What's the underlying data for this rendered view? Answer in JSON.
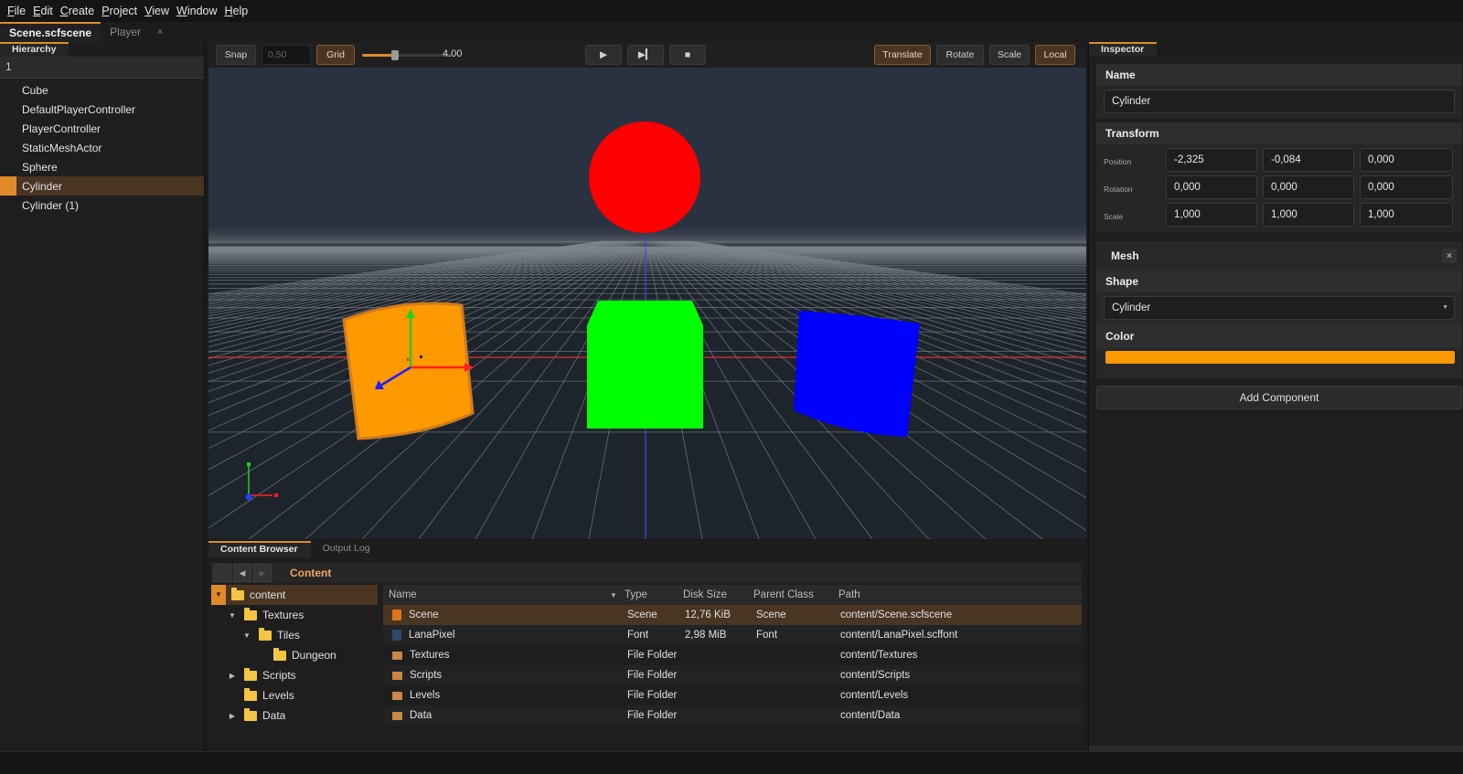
{
  "menu": [
    {
      "accel": "F",
      "rest": "ile"
    },
    {
      "accel": "E",
      "rest": "dit"
    },
    {
      "accel": "C",
      "rest": "reate"
    },
    {
      "accel": "P",
      "rest": "roject"
    },
    {
      "accel": "V",
      "rest": "iew"
    },
    {
      "accel": "W",
      "rest": "indow"
    },
    {
      "accel": "H",
      "rest": "elp"
    }
  ],
  "doc_tabs": {
    "active": "Scene.scfscene",
    "second": "Player",
    "close_glyph": "×"
  },
  "hierarchy": {
    "title": "Hierarchy",
    "search_value": "1",
    "items": [
      "Cube",
      "DefaultPlayerController",
      "PlayerController",
      "StaticMeshActor",
      "Sphere",
      "Cylinder",
      "Cylinder (1)"
    ],
    "selected_index": 5
  },
  "viewport_toolbar": {
    "snap_label": "Snap",
    "snap_value": "0,50",
    "grid_label": "Grid",
    "grid_value": "4.00",
    "grid_slider_level": 0.37,
    "play_glyph": "▶",
    "step_glyph": "▶▎",
    "stop_glyph": "■",
    "translate_label": "Translate",
    "rotate_label": "Rotate",
    "scale_label": "Scale",
    "local_label": "Local"
  },
  "scene_colors": {
    "sky": "#2a3140",
    "floor": "#1e242c",
    "sphere": "#ff0000",
    "cube": "#00ff00",
    "cylinder_left": "#ff9900",
    "cylinder_right": "#0000ff"
  },
  "content_browser": {
    "tabs": [
      "Content Browser",
      "Output Log"
    ],
    "breadcrumb": "Content",
    "nav": {
      "back": "◀",
      "forward": "▶"
    },
    "tree": [
      {
        "label": "content",
        "caret": "▼"
      },
      {
        "label": "Textures",
        "caret": "▼"
      },
      {
        "label": "Tiles",
        "caret": "▼"
      },
      {
        "label": "Dungeon",
        "caret": ""
      },
      {
        "label": "Scripts",
        "caret": "▶"
      },
      {
        "label": "Levels",
        "caret": ""
      },
      {
        "label": "Data",
        "caret": "▶"
      }
    ],
    "columns": {
      "name": "Name",
      "type": "Type",
      "size": "Disk Size",
      "parent": "Parent Class",
      "path": "Path",
      "sort_glyph": "▼"
    },
    "rows": [
      {
        "name": "Scene",
        "type": "Scene",
        "size": "12,76 KiB",
        "parent": "Scene",
        "path": "content/Scene.scfscene",
        "icon": "scene-icon"
      },
      {
        "name": "LanaPixel",
        "type": "Font",
        "size": "2,98 MiB",
        "parent": "Font",
        "path": "content/LanaPixel.scffont",
        "icon": "font-icon"
      },
      {
        "name": "Textures",
        "type": "File Folder",
        "size": "",
        "parent": "",
        "path": "content/Textures",
        "icon": "folder-icon"
      },
      {
        "name": "Scripts",
        "type": "File Folder",
        "size": "",
        "parent": "",
        "path": "content/Scripts",
        "icon": "folder-icon"
      },
      {
        "name": "Levels",
        "type": "File Folder",
        "size": "",
        "parent": "",
        "path": "content/Levels",
        "icon": "folder-icon"
      },
      {
        "name": "Data",
        "type": "File Folder",
        "size": "",
        "parent": "",
        "path": "content/Data",
        "icon": "folder-icon"
      }
    ]
  },
  "inspector": {
    "title": "Inspector",
    "name_header": "Name",
    "name_value": "Cylinder",
    "transform_header": "Transform",
    "position_label": "Position",
    "rotation_label": "Rotation",
    "scale_label": "Scale",
    "position": [
      "-2,325",
      "-0,084",
      "0,000"
    ],
    "rotation": [
      "0,000",
      "0,000",
      "0,000"
    ],
    "scale": [
      "1,000",
      "1,000",
      "1,000"
    ],
    "mesh_header": "Mesh",
    "mesh_close": "×",
    "shape_label": "Shape",
    "shape_value": "Cylinder",
    "color_label": "Color",
    "color_value": "#ff9900",
    "add_component": "Add Component"
  }
}
